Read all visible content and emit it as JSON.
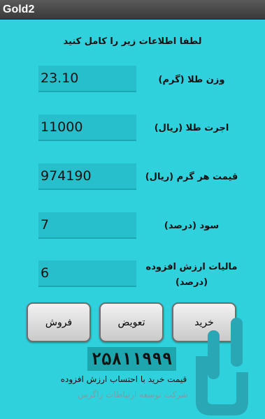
{
  "app": {
    "title": "Gold2"
  },
  "instruction": "لطفا اطلاعات زیر را کامل کنید",
  "fields": [
    {
      "label": "وزن طلا (گرم)",
      "value": "23.10"
    },
    {
      "label": "اجرت طلا (ریال)",
      "value": "11000"
    },
    {
      "label": "قیمت هر گرم (ریال)",
      "value": "974190"
    },
    {
      "label": "سود (درصد)",
      "value": "7"
    },
    {
      "label_line1": "مالیات ارزش افزوده",
      "label_line2": "(درصد)",
      "value": "6"
    }
  ],
  "buttons": {
    "buy": "خرید",
    "swap": "تعویض",
    "sell": "فروش"
  },
  "result": {
    "value": "۲۵۸۱۱۹۹۹"
  },
  "caption": "قیمت خرید با احتساب ارزش افزوده",
  "company": "شرکت توسعه ارتباطات زاگرس",
  "colors": {
    "background": "#2fd1dd",
    "field": "#27bfcb",
    "result_bg": "#1ea6ae"
  }
}
